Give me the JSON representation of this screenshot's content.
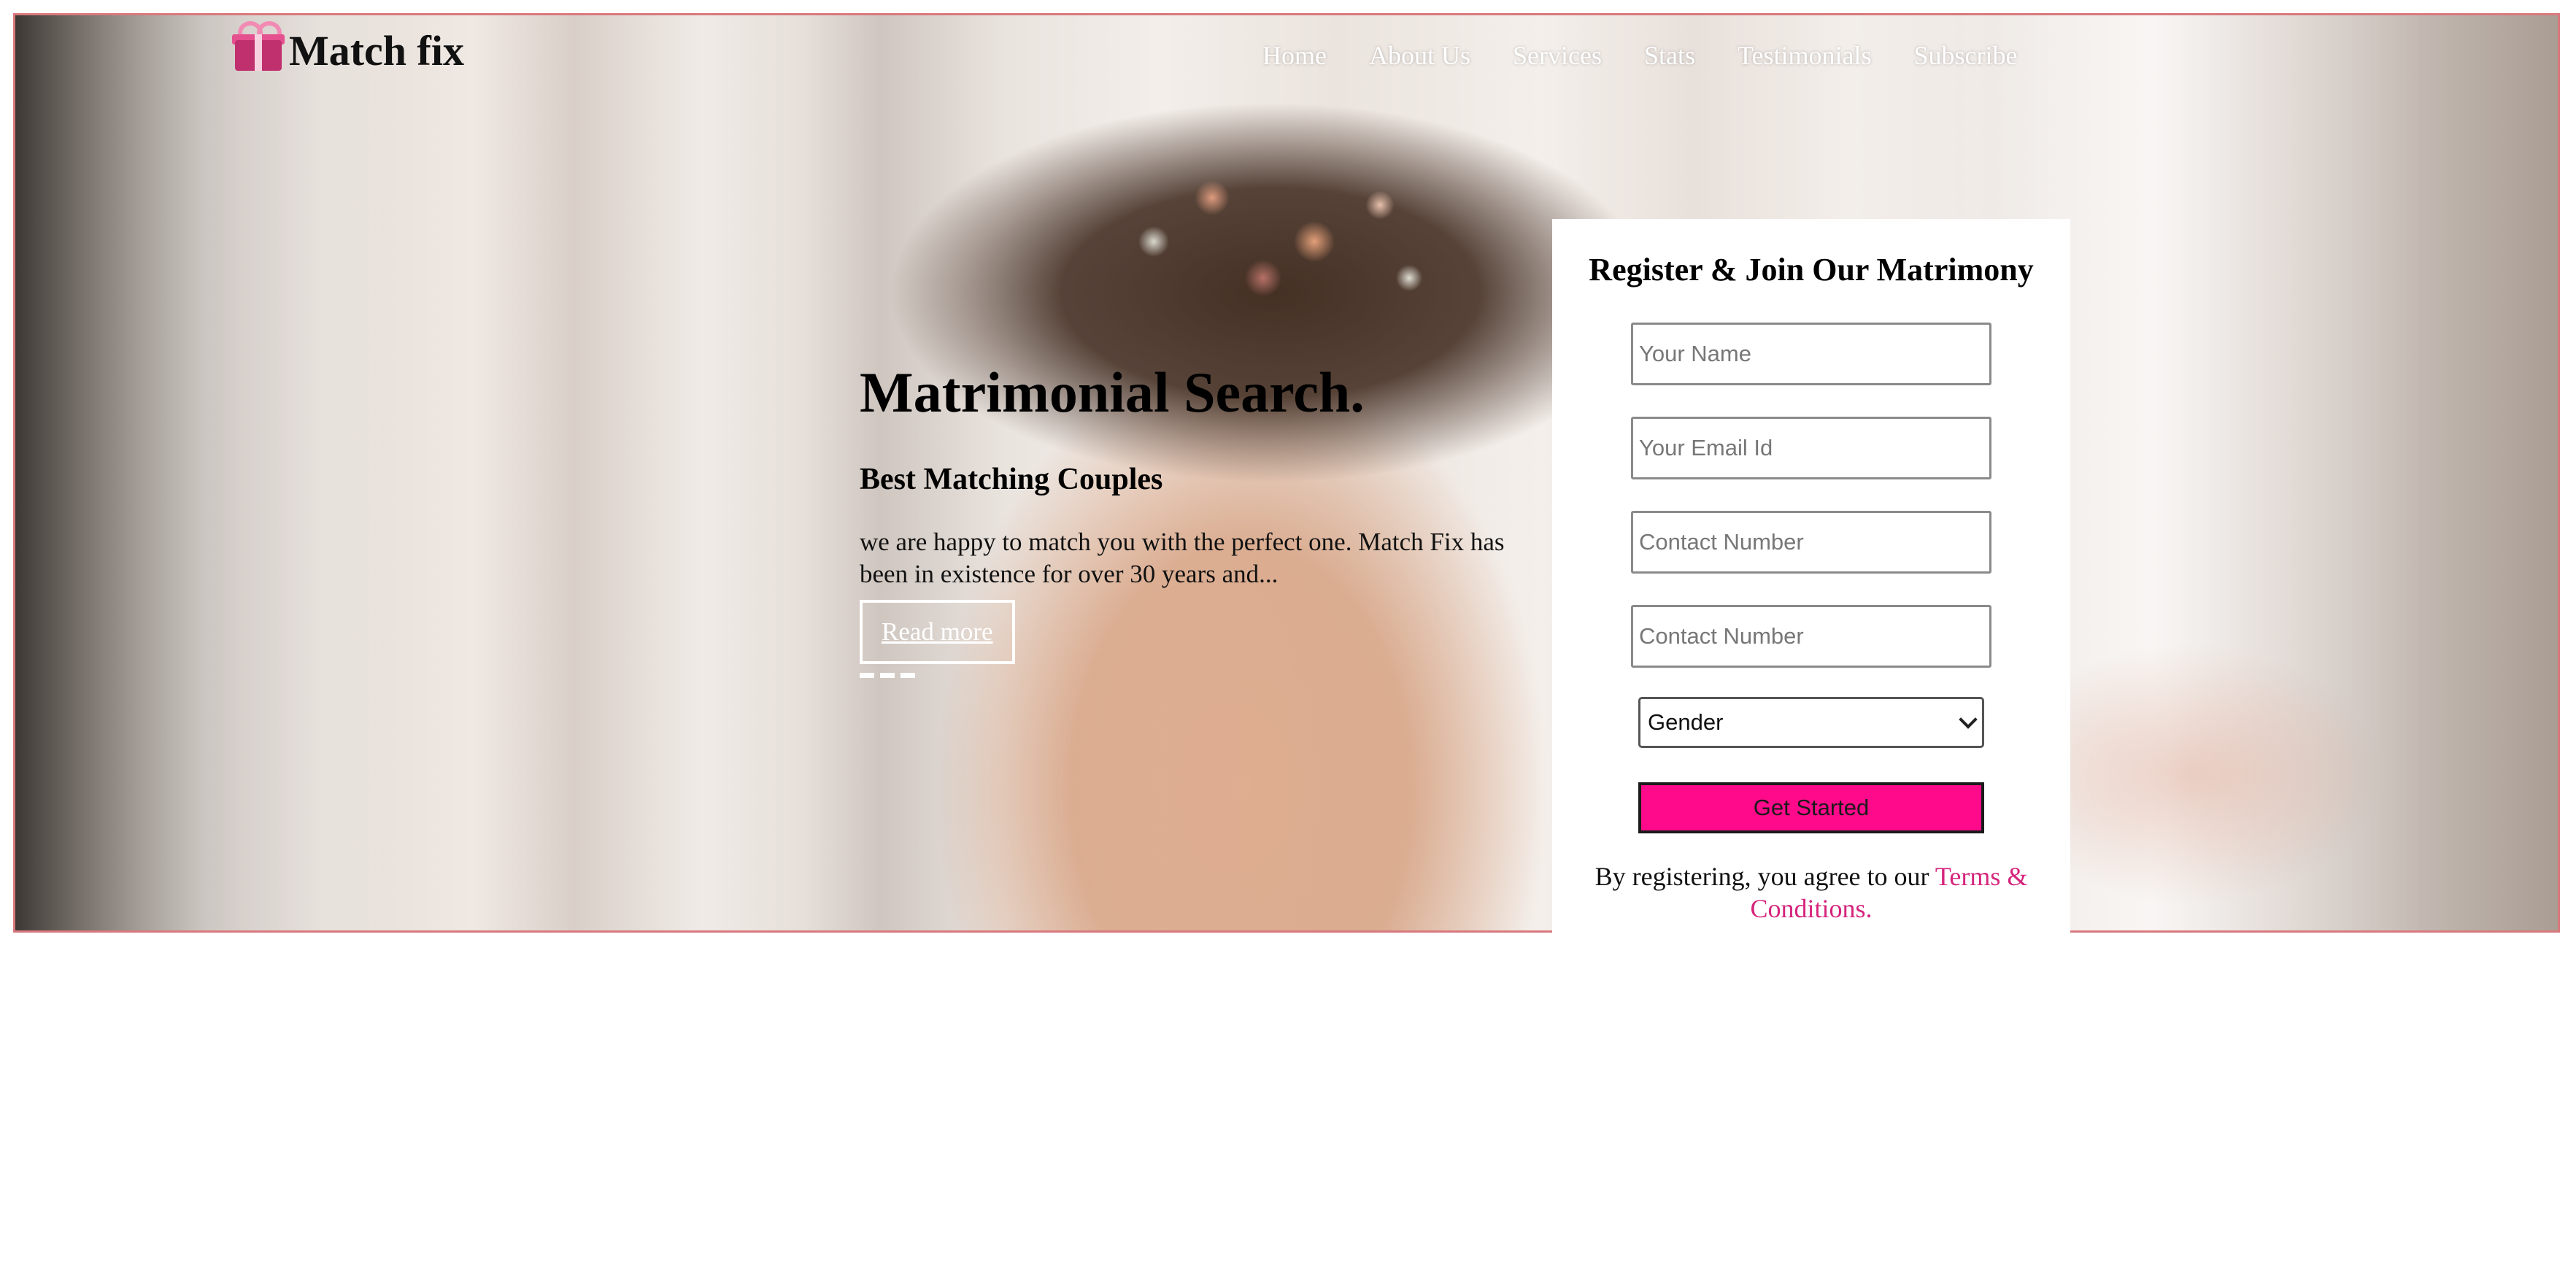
{
  "brand": {
    "name": "Match fix",
    "icon": "gift-icon"
  },
  "nav": {
    "items": [
      {
        "label": "Home"
      },
      {
        "label": "About Us"
      },
      {
        "label": "Services"
      },
      {
        "label": "Stats"
      },
      {
        "label": "Testimonials"
      },
      {
        "label": "Subscribe"
      }
    ]
  },
  "hero": {
    "title": "Matrimonial Search.",
    "subtitle": "Best Matching Couples",
    "text": "we are happy to match you with the perfect one. Match Fix has been in existence for over 30 years and...",
    "read_more": "Read more",
    "slide_count": 3
  },
  "register": {
    "title": "Register & Join Our Matrimony",
    "fields": [
      {
        "placeholder": "Your Name",
        "value": ""
      },
      {
        "placeholder": "Your Email Id",
        "value": ""
      },
      {
        "placeholder": "Contact Number",
        "value": ""
      },
      {
        "placeholder": "Contact Number",
        "value": ""
      }
    ],
    "gender_selected": "Gender",
    "submit_label": "Get Started",
    "terms_prefix": "By registering, you agree to our ",
    "terms_link": "Terms & Conditions."
  },
  "colors": {
    "accent": "#ff0a8a",
    "link": "#d6247c",
    "hero_border": "#d9797e",
    "brand_icon": "#c0306e"
  }
}
